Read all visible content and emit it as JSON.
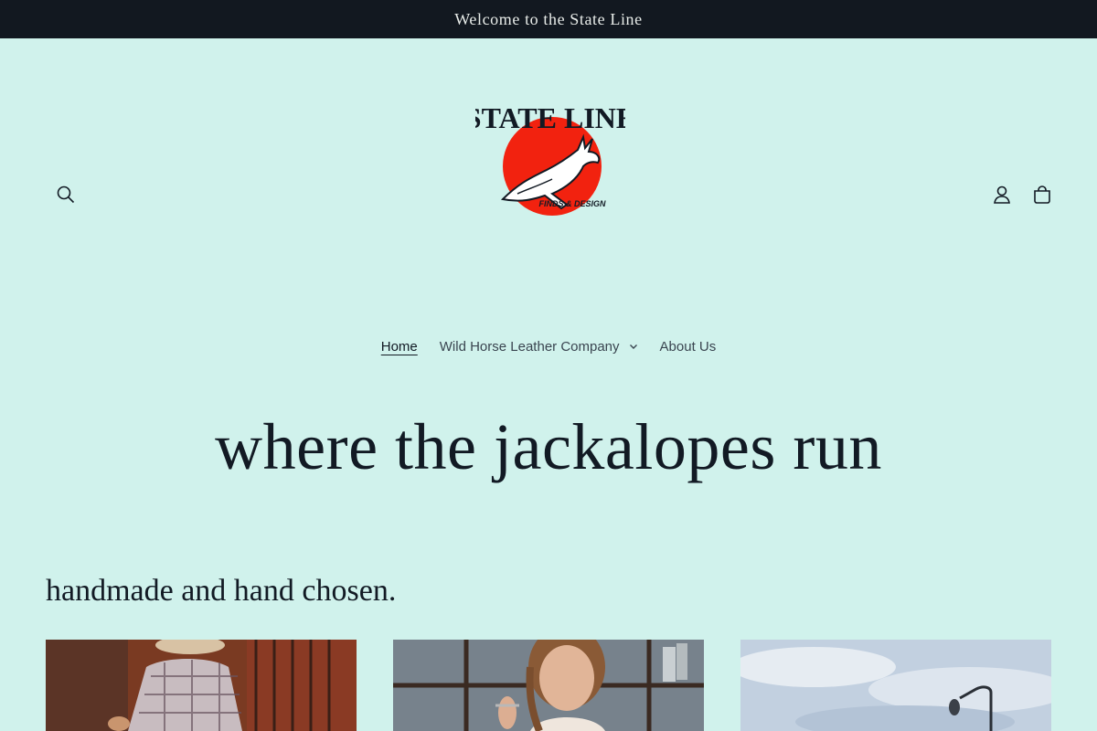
{
  "announcement": {
    "text": "Welcome to the State Line"
  },
  "header": {
    "search_icon": "search-icon",
    "account_icon": "account-icon",
    "cart_icon": "cart-icon",
    "logo": {
      "title": "STATE LINE",
      "subtitle": "FINDS & DESIGN"
    }
  },
  "nav": {
    "items": [
      {
        "label": "Home",
        "active": true
      },
      {
        "label": "Wild Horse Leather Company",
        "has_dropdown": true
      },
      {
        "label": "About Us"
      }
    ]
  },
  "hero": {
    "title": "where the jackalopes run"
  },
  "collection": {
    "heading": "handmade and hand chosen.",
    "cards": [
      {
        "image": "cowboy-plaid-shirt-photo"
      },
      {
        "image": "woman-braided-hair-photo"
      },
      {
        "image": "sky-streetlamp-photo"
      }
    ]
  },
  "colors": {
    "background": "#d0f2ec",
    "announcement_bg": "#121820",
    "logo_red": "#f2220f"
  }
}
